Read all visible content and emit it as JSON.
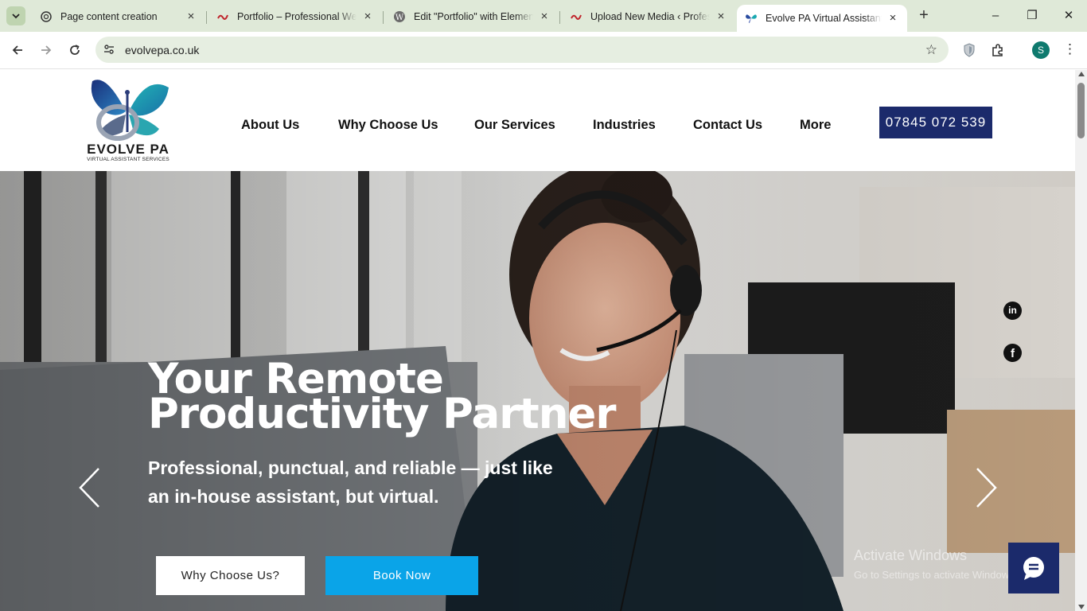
{
  "browser": {
    "tabs": [
      {
        "title": "Page content creation",
        "icon": "chatgpt-icon"
      },
      {
        "title": "Portfolio – Professional Web",
        "icon": "portfolio-icon"
      },
      {
        "title": "Edit \"Portfolio\" with Element",
        "icon": "wordpress-icon"
      },
      {
        "title": "Upload New Media ‹ Profess",
        "icon": "portfolio-icon"
      },
      {
        "title": "Evolve PA Virtual Assistant S",
        "icon": "evolve-butterfly-icon",
        "active": true
      }
    ],
    "url": "evolvepa.co.uk",
    "profile_initial": "S",
    "close_glyph": "×",
    "new_tab_glyph": "+",
    "window_controls": {
      "minimize": "–",
      "restore": "❐",
      "close": "✕"
    },
    "menu_glyph": "⋮",
    "star_glyph": "☆"
  },
  "site": {
    "logo": {
      "title": "EVOLVE PA",
      "subtitle": "VIRTUAL ASSISTANT SERVICES"
    },
    "nav": [
      "About Us",
      "Why Choose Us",
      "Our Services",
      "Industries",
      "Contact Us",
      "More"
    ],
    "phone": "07845 072 539",
    "hero": {
      "title": "Your Remote Productivity Partner",
      "subtitle": "Professional, punctual, and reliable — just like an in-house assistant, but virtual.",
      "buttons": {
        "why": "Why Choose Us?",
        "book": "Book Now"
      }
    },
    "social": {
      "linkedin": "in",
      "facebook": "f"
    },
    "watermark": {
      "line1": "Activate Windows",
      "line2": "Go to Settings to activate Windows."
    }
  },
  "colors": {
    "phone_button": "#1b2a6b",
    "book_button": "#0aa4e8",
    "chat_button": "#1b2a6b",
    "tab_strip": "#dfe9d8"
  }
}
